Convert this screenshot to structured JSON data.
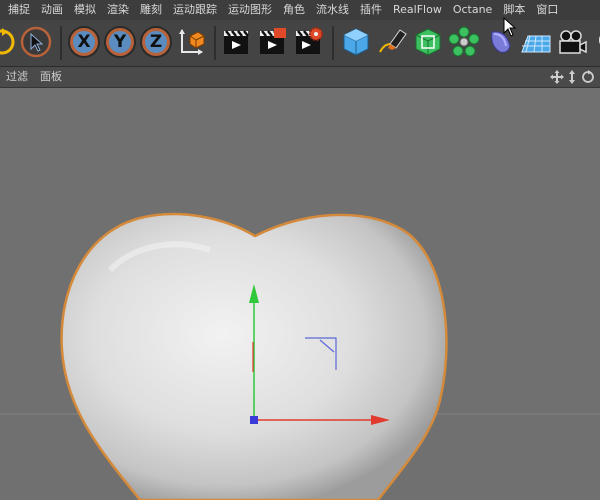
{
  "menu": {
    "items": [
      "捕捉",
      "动画",
      "模拟",
      "渲染",
      "雕刻",
      "运动跟踪",
      "运动图形",
      "角色",
      "流水线",
      "插件",
      "RealFlow",
      "Octane",
      "脚本",
      "窗口"
    ]
  },
  "toolbar": {
    "axis_x": "X",
    "axis_y": "Y",
    "axis_z": "Z"
  },
  "viewport_menu": {
    "filter": "过滤",
    "panel": "面板"
  },
  "colors": {
    "menubar": "#3d3d3d",
    "toolbar": "#444444",
    "viewport_bg": "#707070",
    "selection_outline": "#d48a3a",
    "axis_x": "#e23a2e",
    "axis_y": "#2ec83a",
    "axis_z": "#3a3ad8"
  }
}
